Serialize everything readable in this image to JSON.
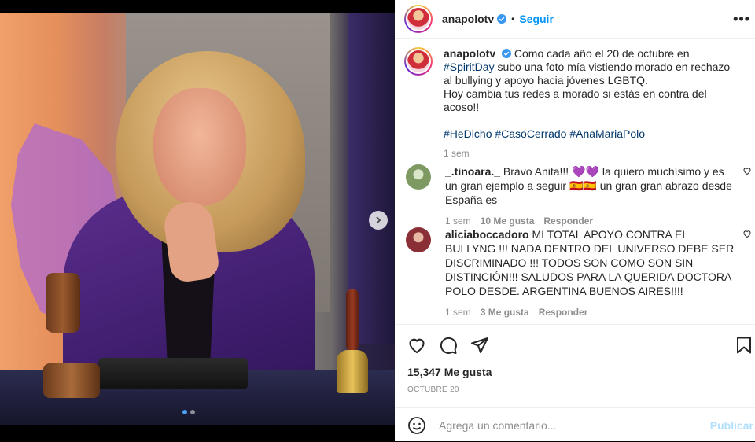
{
  "post": {
    "username": "anapolotv",
    "follow_label": "Seguir",
    "separator": "•",
    "more_label": "•••"
  },
  "caption": {
    "username": "anapolotv",
    "text_part1": "Como cada año el 20 de octubre en ",
    "hashtag_spirit": "#SpiritDay",
    "text_part2": " subo una foto mía vistiendo morado en rechazo al bullying y apoyo hacia jóvenes LGBTQ.",
    "text_line2": "Hoy cambia tus redes a morado si estás en contra del acoso!!",
    "hashtags": [
      "#HeDicho",
      "#CasoCerrado",
      "#AnaMariaPolo"
    ],
    "time": "1 sem"
  },
  "comments": [
    {
      "username": "_.tinoara._",
      "text": "Bravo Anita!!! 💜💜 la quiero muchísimo y es un gran ejemplo a seguir 🇪🇸🇪🇸 un gran gran abrazo desde España es",
      "time": "1 sem",
      "likes": "10 Me gusta",
      "reply": "Responder",
      "avatar_color": "#7e9a62"
    },
    {
      "username": "aliciaboccadoro",
      "text": "MI TOTAL APOYO CONTRA EL BULLYNG !!! NADA DENTRO DEL UNIVERSO DEBE SER DISCRIMINADO !!! TODOS SON COMO SON SIN DISTINCIÓN!!! SALUDOS PARA LA QUERIDA DOCTORA POLO DESDE. ARGENTINA BUENOS AIRES!!!!",
      "time": "1 sem",
      "likes": "3 Me gusta",
      "reply": "Responder",
      "avatar_color": "#8a2f35"
    }
  ],
  "actions": {
    "likes": "15,347 Me gusta",
    "date": "OCTUBRE 20",
    "icons": [
      "heart-icon",
      "comment-icon",
      "share-icon",
      "bookmark-icon"
    ]
  },
  "add_comment": {
    "placeholder": "Agrega un comentario...",
    "post_label": "Publicar"
  },
  "carousel": {
    "slides": 2,
    "current": 1
  },
  "colors": {
    "link_blue": "#0095f6",
    "hashtag": "#00376b",
    "muted": "#8e8e8e",
    "post_disabled": "#b2dffc"
  }
}
